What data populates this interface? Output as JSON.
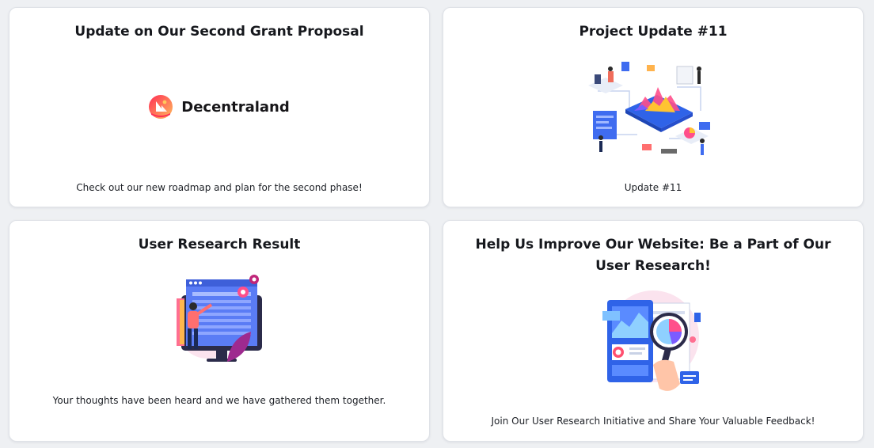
{
  "cards": [
    {
      "title": "Update on Our Second Grant Proposal",
      "logo_text": "Decentraland",
      "logo_icon": "decentraland-logo-icon",
      "description": "Check out our new roadmap and plan for the second phase!"
    },
    {
      "title": "Project Update #11",
      "image": "isometric-data-analytics-illustration",
      "description": "Update #11"
    },
    {
      "title": "User Research Result",
      "image": "user-research-dashboard-illustration",
      "description": "Your thoughts have been heard and we have gathered them together."
    },
    {
      "title": "Help Us Improve Our Website: Be a Part of Our User Research!",
      "image": "magnifier-analytics-illustration",
      "description": "Join Our User Research Initiative and Share Your Valuable Feedback!"
    }
  ],
  "colors": {
    "background": "#eef0f3",
    "card": "#ffffff",
    "title_text": "#16181d",
    "logo_red": "#ff2d55",
    "logo_orange": "#ffbc5b"
  }
}
